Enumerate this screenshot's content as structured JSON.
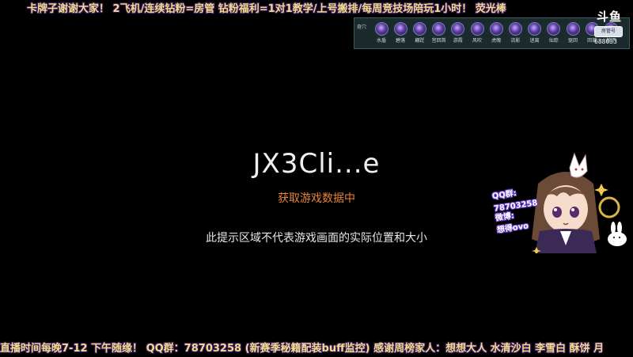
{
  "overlay": {
    "top_marquee": "卡牌子谢谢大家！ 2飞机/连续钻粉=房管  钻粉福利=1对1教学/上号搬排/每周竞技场陪玩1小时！ 荧光棒",
    "bottom_marquee": "直播时间每晚7-12 下午随缘！ QQ群：78703258  (新赛季秘籍配装buff监控) 感谢周榜家人：想想大人  水清沙白  李雪白  酥饼  月",
    "douyu_logo": "斗鱼",
    "rank_badge": "房管号"
  },
  "skill_bar": {
    "title": "奇穴",
    "slots": [
      {
        "label": "水盾",
        "icon": "skill-icon"
      },
      {
        "label": "碧落",
        "icon": "skill-icon"
      },
      {
        "label": "翩跹",
        "icon": "skill-icon"
      },
      {
        "label": "宫回首",
        "icon": "skill-icon"
      },
      {
        "label": "游霞",
        "icon": "skill-icon"
      },
      {
        "label": "风吹",
        "icon": "skill-icon"
      },
      {
        "label": "虎魄",
        "icon": "skill-icon"
      },
      {
        "label": "流影",
        "icon": "skill-icon"
      },
      {
        "label": "迷离",
        "icon": "skill-icon"
      },
      {
        "label": "仙踪",
        "icon": "skill-icon"
      },
      {
        "label": "驱回",
        "icon": "skill-icon"
      },
      {
        "label": "回首",
        "icon": "skill-icon"
      },
      {
        "label": "梳下",
        "icon": "skill-icon"
      }
    ],
    "counter": "688033"
  },
  "client": {
    "title": "JX3Cli...e",
    "status": "获取游戏数据中",
    "hint": "此提示区域不代表游戏画面的实际位置和大小"
  },
  "sticker": {
    "qq_line": "QQ群:",
    "qq_number": "78703258",
    "weibo_line": "微博:",
    "weibo_name": "想得ovo"
  },
  "colors": {
    "background": "#000000",
    "status_orange": "#e8843a",
    "marquee_gold": "#f2dc8e",
    "sticker_outline": "#6a3fd0"
  }
}
